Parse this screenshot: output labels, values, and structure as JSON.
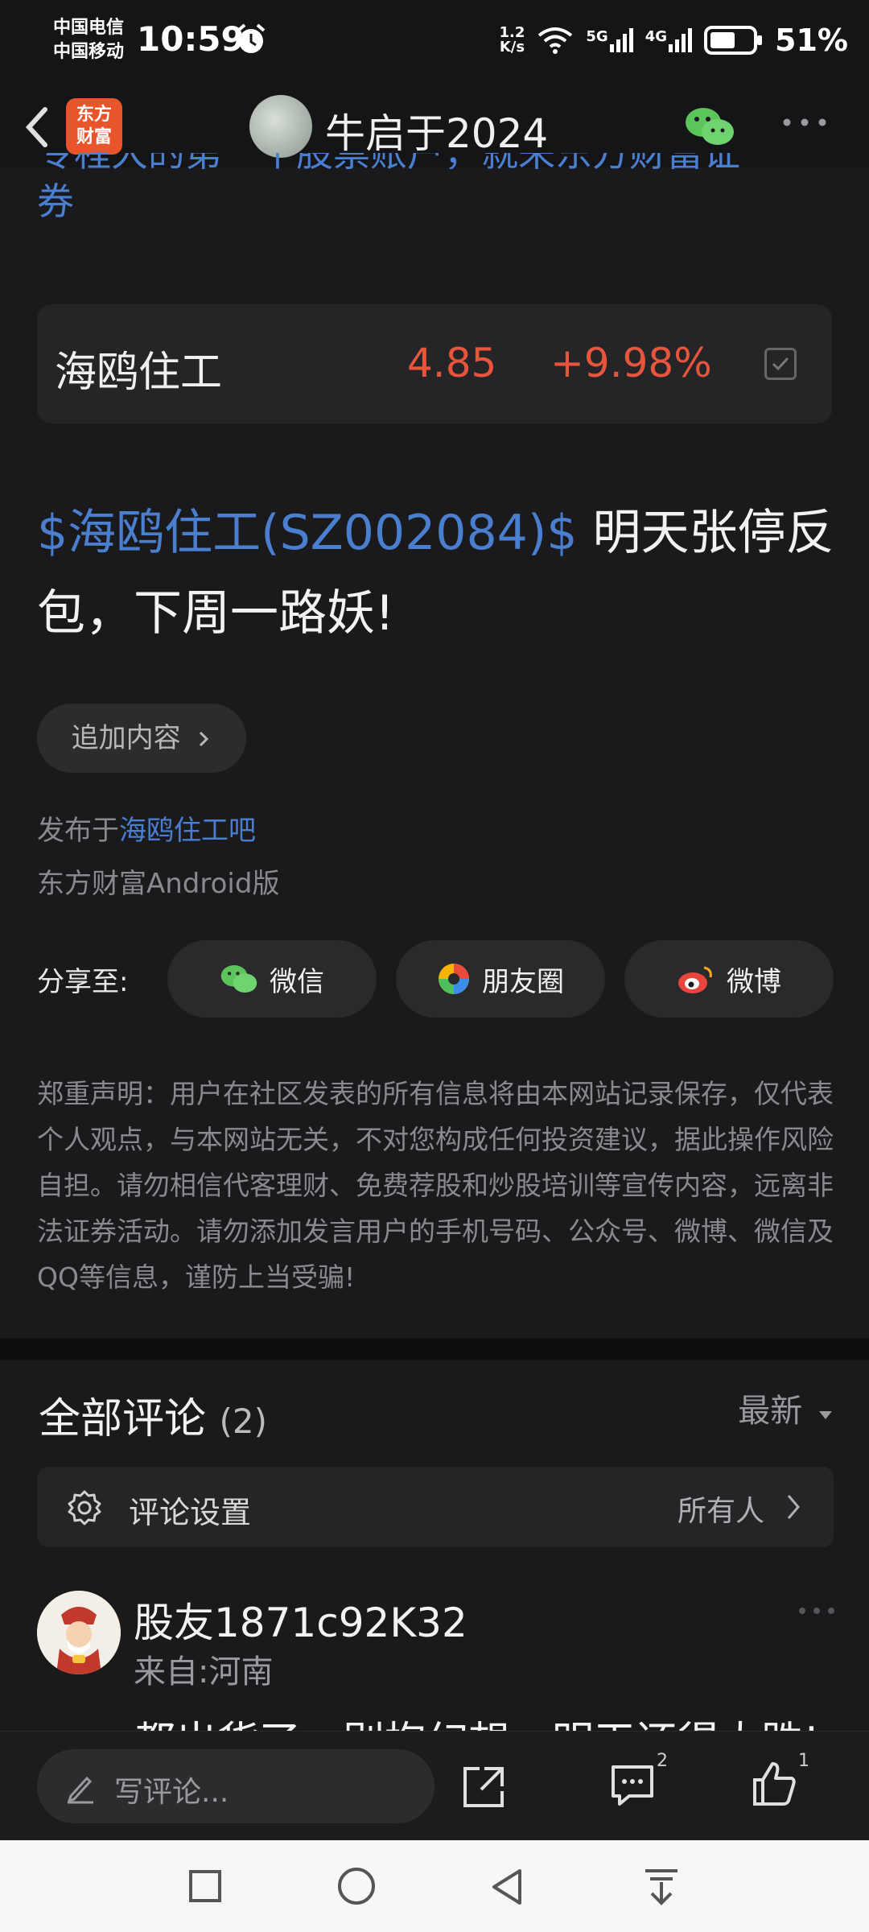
{
  "status_bar": {
    "carrier1": "中国电信",
    "carrier2": "中国移动",
    "time": "10:59",
    "speed_value": "1.2",
    "speed_unit": "K/s",
    "net1": "5G",
    "net2": "4G",
    "battery": "51%"
  },
  "header": {
    "app_logo_line1": "东方",
    "app_logo_line2": "财富",
    "title": "牛启于2024"
  },
  "content": {
    "cut_text_line1": "专程大的第一个股票账户，就来东方财富证",
    "cut_text_line2": "券",
    "stock_card": {
      "name": "海鸥住工",
      "price": "4.85",
      "change": "+9.98%"
    },
    "post_link": "$海鸥住工(SZ002084)$",
    "post_text": " 明天张停反包，下周一路妖!",
    "add_content_label": "追加内容",
    "published_prefix": "发布于",
    "published_bar": "海鸥住工吧",
    "client": "东方财富Android版",
    "share_label": "分享至:",
    "share": {
      "wechat": "微信",
      "moments": "朋友圈",
      "weibo": "微博"
    },
    "disclaimer": "郑重声明：用户在社区发表的所有信息将由本网站记录保存，仅代表个人观点，与本网站无关，不对您构成任何投资建议，据此操作风险自担。请勿相信代客理财、免费荐股和炒股培训等宣传内容，远离非法证券活动。请勿添加发言用户的手机号码、公众号、微博、微信及QQ等信息，谨防上当受骗!"
  },
  "comments": {
    "title": "全部评论",
    "count": "(2)",
    "sort": "最新",
    "settings_label": "评论设置",
    "settings_value": "所有人",
    "first": {
      "user": "股友1871c92K32",
      "location": "来自:河南",
      "text": "都出货了，别抱幻想，明天还得大跌!"
    }
  },
  "action_bar": {
    "write_placeholder": "写评论...",
    "comment_count": "2",
    "like_count": "1"
  },
  "colors": {
    "background": "#1a1a1c",
    "link": "#4a7fd0",
    "up_red": "#e8553c",
    "brand_orange": "#e8552b"
  }
}
